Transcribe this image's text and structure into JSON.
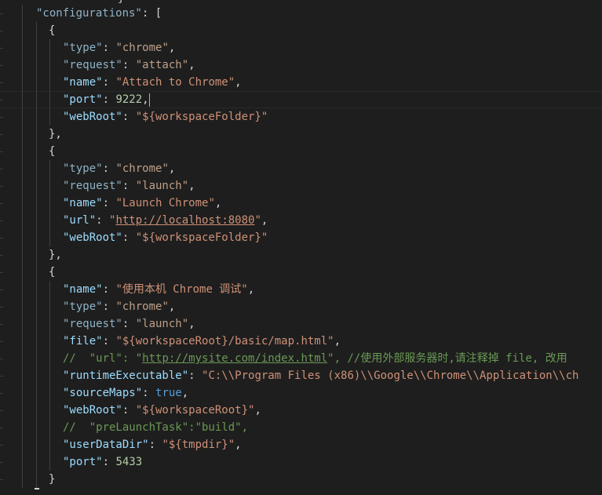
{
  "editor": {
    "top_fragment": "}",
    "lines": {
      "l0_key": "\"configurations\"",
      "l0_rest": ": [",
      "l1": "{",
      "l2_key": "\"type\"",
      "l2_val": "\"chrome\"",
      "l3_key": "\"request\"",
      "l3_val": "\"attach\"",
      "l4_key": "\"name\"",
      "l4_val": "\"Attach to Chrome\"",
      "l5_key": "\"port\"",
      "l5_val": "9222",
      "l6_key": "\"webRoot\"",
      "l6_val": "\"${workspaceFolder}\"",
      "l7": "},",
      "l8": "{",
      "l9_key": "\"type\"",
      "l9_val": "\"chrome\"",
      "l10_key": "\"request\"",
      "l10_val": "\"launch\"",
      "l11_key": "\"name\"",
      "l11_val": "\"Launch Chrome\"",
      "l12_key": "\"url\"",
      "l12_q1": "\"",
      "l12_val": "http://localhost:8080",
      "l12_q2": "\"",
      "l13_key": "\"webRoot\"",
      "l13_val": "\"${workspaceFolder}\"",
      "l14": "},",
      "l15": "{",
      "l16_key": "\"name\"",
      "l16_val": "\"使用本机 Chrome 调试\"",
      "l17_key": "\"type\"",
      "l17_val": "\"chrome\"",
      "l18_key": "\"request\"",
      "l18_val": "\"launch\"",
      "l19_key": "\"file\"",
      "l19_val": "\"${workspaceRoot}/basic/map.html\"",
      "l20_a": "//  \"url\": \"",
      "l20_link": "http://mysite.com/index.html",
      "l20_b": "\", //使用外部服务器时,请注释掉 file, 改用",
      "l21_key": "\"runtimeExecutable\"",
      "l21_val": "\"C:\\\\Program Files (x86)\\\\Google\\\\Chrome\\\\Application\\\\ch",
      "l22_key": "\"sourceMaps\"",
      "l22_val": "true",
      "l23_key": "\"webRoot\"",
      "l23_val": "\"${workspaceRoot}\"",
      "l24": "//  \"preLaunchTask\":\"build\",",
      "l25_key": "\"userDataDir\"",
      "l25_val": "\"${tmpdir}\"",
      "l26_key": "\"port\"",
      "l26_val": "5433",
      "l27": "}"
    }
  }
}
